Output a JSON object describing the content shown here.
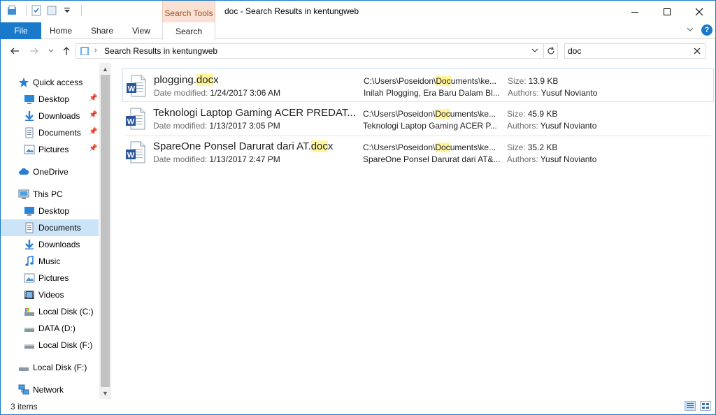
{
  "window": {
    "title": "doc - Search Results in kentungweb",
    "contextual_tab": "Search Tools"
  },
  "ribbon": {
    "tabs": [
      {
        "label": "File"
      },
      {
        "label": "Home"
      },
      {
        "label": "Share"
      },
      {
        "label": "View"
      },
      {
        "label": "Search"
      }
    ],
    "help_label": "?"
  },
  "address_bar": {
    "path": "Search Results in kentungweb"
  },
  "search": {
    "value": "doc"
  },
  "nav_pane": {
    "items": [
      {
        "label": "Quick access",
        "icon": "star-icon",
        "indent": 0
      },
      {
        "label": "Desktop",
        "icon": "desktop-icon",
        "indent": 1,
        "pinned": true
      },
      {
        "label": "Downloads",
        "icon": "download-icon",
        "indent": 1,
        "pinned": true
      },
      {
        "label": "Documents",
        "icon": "documents-icon",
        "indent": 1,
        "pinned": true
      },
      {
        "label": "Pictures",
        "icon": "pictures-icon",
        "indent": 1,
        "pinned": true
      },
      {
        "label": "OneDrive",
        "icon": "cloud-icon",
        "indent": 0
      },
      {
        "label": "This PC",
        "icon": "computer-icon",
        "indent": 0
      },
      {
        "label": "Desktop",
        "icon": "desktop-icon",
        "indent": 1
      },
      {
        "label": "Documents",
        "icon": "documents-icon",
        "indent": 1,
        "selected": true
      },
      {
        "label": "Downloads",
        "icon": "download-icon",
        "indent": 1
      },
      {
        "label": "Music",
        "icon": "music-icon",
        "indent": 1
      },
      {
        "label": "Pictures",
        "icon": "pictures-icon",
        "indent": 1
      },
      {
        "label": "Videos",
        "icon": "videos-icon",
        "indent": 1
      },
      {
        "label": "Local Disk (C:)",
        "icon": "system-drive-icon",
        "indent": 1
      },
      {
        "label": "DATA (D:)",
        "icon": "drive-icon",
        "indent": 1
      },
      {
        "label": "Local Disk (F:)",
        "icon": "drive-icon",
        "indent": 1
      },
      {
        "label": "Local Disk (F:)",
        "icon": "drive-icon",
        "indent": 0
      },
      {
        "label": "Network",
        "icon": "network-icon",
        "indent": 0
      }
    ]
  },
  "results": {
    "date_label": "Date modified:",
    "size_label": "Size:",
    "authors_label": "Authors:",
    "items": [
      {
        "name_pre": "plogging.",
        "name_hl": "doc",
        "name_post": "x",
        "date": "1/24/2017 3:06 AM",
        "path_pre": "C:\\Users\\Poseidon\\",
        "path_hl": "Doc",
        "path_post": "uments\\ke...",
        "snippet": "Inilah Plogging, Era Baru Dalam Bl...",
        "size": "13.9 KB",
        "authors": "Yusuf Novianto"
      },
      {
        "name_pre": "Teknologi Laptop Gaming ACER PREDAT...",
        "name_hl": "",
        "name_post": "",
        "date": "1/13/2017 3:05 PM",
        "path_pre": "C:\\Users\\Poseidon\\",
        "path_hl": "Doc",
        "path_post": "uments\\ke...",
        "snippet": "Teknologi Laptop Gaming ACER P...",
        "size": "45.9 KB",
        "authors": "Yusuf Novianto"
      },
      {
        "name_pre": "SpareOne Ponsel Darurat dari AT.",
        "name_hl": "doc",
        "name_post": "x",
        "date": "1/13/2017 2:47 PM",
        "path_pre": "C:\\Users\\Poseidon\\",
        "path_hl": "Doc",
        "path_post": "uments\\ke...",
        "snippet": "SpareOne Ponsel Darurat dari AT&...",
        "size": "35.2 KB",
        "authors": "Yusuf Novianto"
      }
    ]
  },
  "status": {
    "item_count": "3 items"
  },
  "colors": {
    "accent": "#1979ca",
    "highlight": "#fff59d",
    "selected": "#cce4f7",
    "contextual": "#fbe1d3"
  }
}
